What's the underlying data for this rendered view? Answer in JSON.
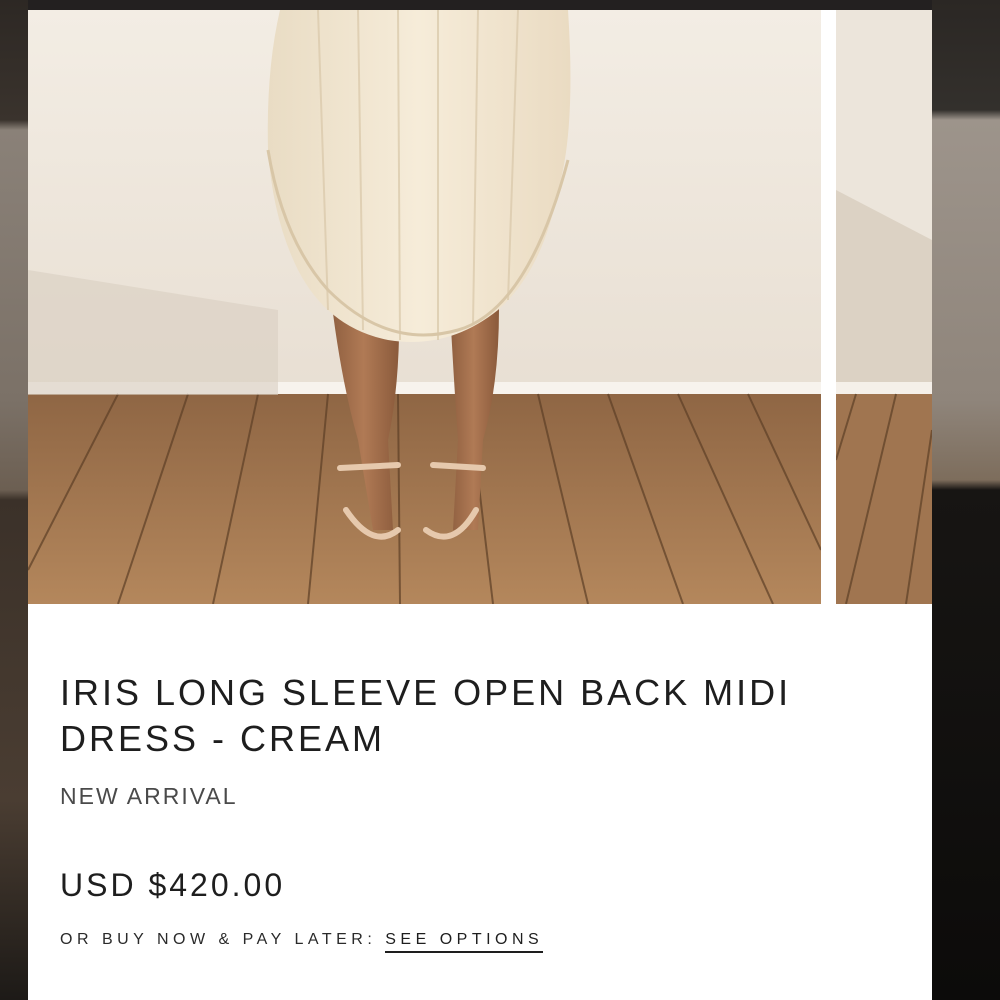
{
  "product": {
    "title": "IRIS LONG SLEEVE OPEN BACK MIDI DRESS - CREAM",
    "badge": "NEW ARRIVAL",
    "price": "USD $420.00",
    "pay_later_prefix": "OR BUY NOW & PAY LATER:",
    "pay_later_link": "SEE OPTIONS"
  },
  "colors": {
    "wall": "#efe8de",
    "floor": "#a57a50",
    "dress": "#f2e6d0",
    "text": "#1e1e1e"
  }
}
